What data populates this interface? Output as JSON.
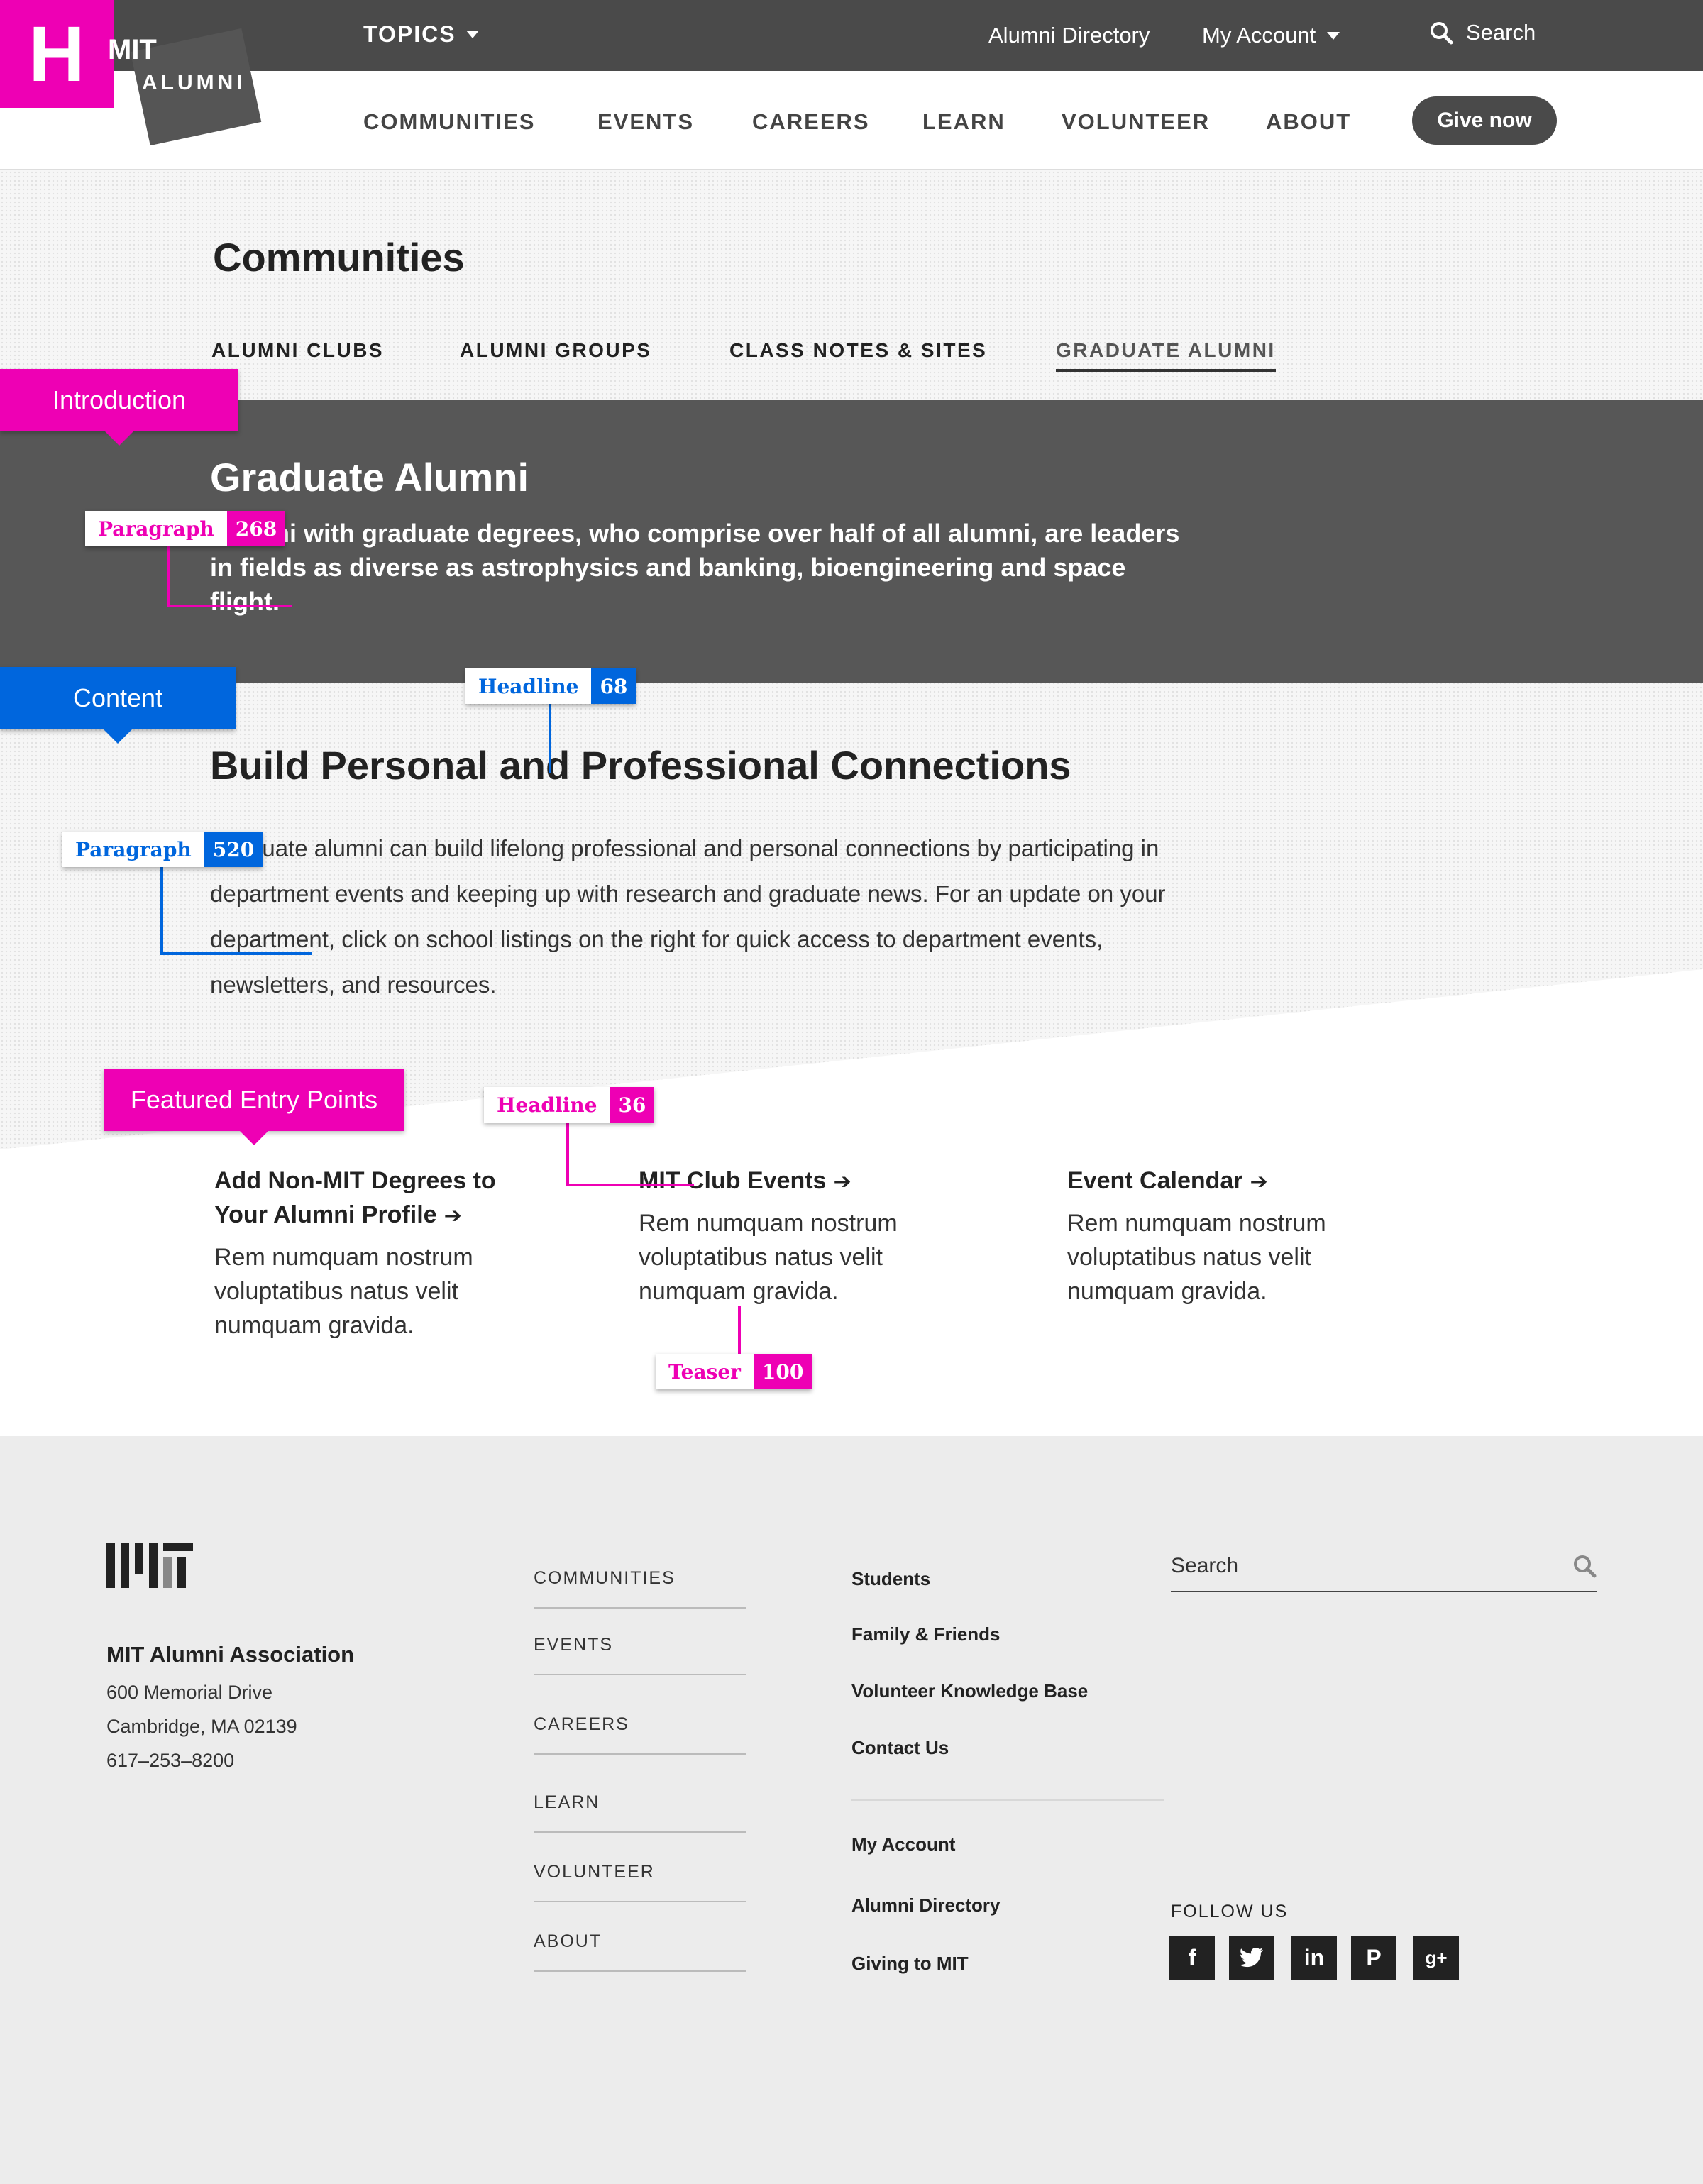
{
  "logo": {
    "letter": "H",
    "mit": "MIT",
    "alumni": "ALUMNI"
  },
  "topbar": {
    "topics": "TOPICS",
    "alumni_directory": "Alumni Directory",
    "my_account": "My Account",
    "search": "Search"
  },
  "mainnav": {
    "items": [
      "COMMUNITIES",
      "EVENTS",
      "CAREERS",
      "LEARN",
      "VOLUNTEER",
      "ABOUT"
    ],
    "give": "Give now"
  },
  "page": {
    "title": "Communities",
    "tabs": [
      "ALUMNI CLUBS",
      "ALUMNI GROUPS",
      "CLASS NOTES & SITES",
      "GRADUATE ALUMNI"
    ],
    "active_tab": "GRADUATE ALUMNI"
  },
  "intro": {
    "heading": "Graduate Alumni",
    "paragraph": "Alumni with graduate degrees, who comprise over half of all alumni, are leaders in fields as diverse as astrophysics and banking, bioengineering and space flight."
  },
  "content": {
    "heading": "Build Personal and Professional Connections",
    "paragraph": "Graduate alumni can build lifelong professional and personal connections by participating in department events and keeping up with research and graduate news. For an update on your department, click on school listings on the right for quick access to department events, newsletters, and resources."
  },
  "featured": [
    {
      "title": "Add Non-MIT Degrees to Your Alumni Profile",
      "text": "Rem numquam nostrum voluptatibus natus velit numquam gravida."
    },
    {
      "title": "MIT Club Events",
      "text": "Rem numquam nostrum voluptatibus natus velit numquam gravida."
    },
    {
      "title": "Event Calendar",
      "text": "Rem numquam nostrum voluptatibus natus velit numquam gravida."
    }
  ],
  "annotations": {
    "introduction": "Introduction",
    "content": "Content",
    "featured": "Featured Entry Points",
    "paragraph_intro": {
      "label": "Paragraph",
      "count": "268"
    },
    "headline_content": {
      "label": "Headline",
      "count": "68"
    },
    "paragraph_content": {
      "label": "Paragraph",
      "count": "520"
    },
    "headline_featured": {
      "label": "Headline",
      "count": "36"
    },
    "teaser": {
      "label": "Teaser",
      "count": "100"
    }
  },
  "footer": {
    "org": "MIT Alumni Association",
    "address": [
      "600 Memorial Drive",
      "Cambridge, MA 02139",
      "617–253–8200"
    ],
    "nav": [
      "COMMUNITIES",
      "EVENTS",
      "CAREERS",
      "LEARN",
      "VOLUNTEER",
      "ABOUT"
    ],
    "links_top": [
      "Students",
      "Family & Friends",
      "Volunteer Knowledge Base",
      "Contact Us"
    ],
    "links_bottom": [
      "My Account",
      "Alumni Directory",
      "Giving to MIT"
    ],
    "search_placeholder": "Search",
    "follow": "FOLLOW US",
    "social_icons": [
      "facebook-icon",
      "twitter-icon",
      "linkedin-icon",
      "pinterest-icon",
      "google-plus-icon"
    ]
  },
  "colors": {
    "annotation_pink": "#ee00b4",
    "annotation_blue": "#0066dd",
    "dark_band": "#575757",
    "topbar": "#4a4a4a"
  }
}
